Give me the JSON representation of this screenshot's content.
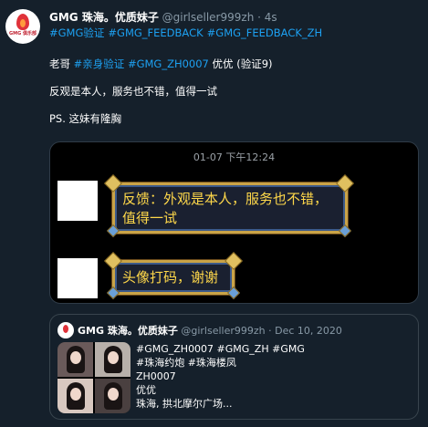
{
  "tweet": {
    "author_name": "GMG 珠海。优质妹子",
    "author_handle": "@girlseller999zh",
    "separator": "·",
    "time": "4s",
    "avatar_label": "GMG 俱乐部",
    "hashtags": [
      "#GMG验证",
      "#GMG_FEEDBACK",
      "#GMG_FEEDBACK_ZH"
    ],
    "line1_prefix": "老哥",
    "line1_tag1": "#亲身验证",
    "line1_tag2": "#GMG_ZH0007",
    "line1_suffix": "优优 (验证9)",
    "line2": "反观是本人，服务也不错，值得一试",
    "line3": "PS. 这妹有隆胸"
  },
  "media": {
    "timestamp": "01-07 下午12:24",
    "message1": "反馈：外观是本人，服务也不错，值得一试",
    "message2": "头像打码，谢谢"
  },
  "quote": {
    "author_name": "GMG 珠海。优质妹子",
    "meta": "@girlseller999zh · Dec 10, 2020",
    "lines": [
      "#GMG_ZH0007 #GMG_ZH #GMG",
      "#珠海约炮 #珠海楼凤",
      "ZH0007",
      "优优",
      "珠海, 拱北摩尔广场..."
    ]
  }
}
